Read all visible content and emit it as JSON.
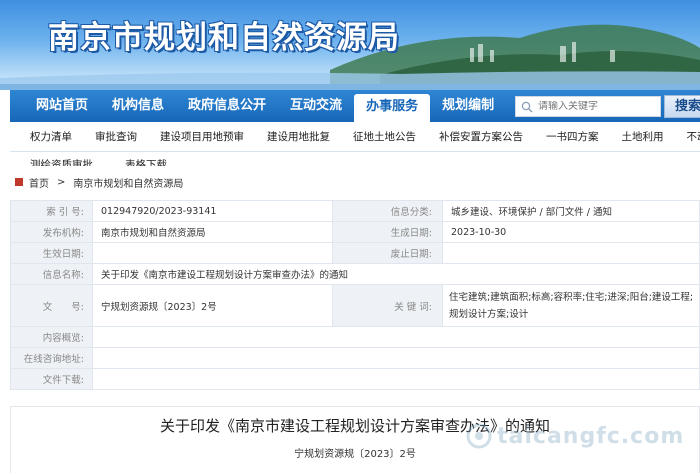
{
  "banner": {
    "title": "南京市规划和自然资源局"
  },
  "nav": {
    "items": [
      "网站首页",
      "机构信息",
      "政府信息公开",
      "互动交流",
      "办事服务",
      "规划编制"
    ],
    "active_index": 4,
    "search_placeholder": "请输入关键字",
    "search_button": "搜索"
  },
  "subnav": {
    "items": [
      "权力清单",
      "审批查询",
      "建设项目用地预审",
      "建设用地批复",
      "征地土地公告",
      "补偿安置方案公告",
      "一书四方案",
      "土地利用",
      "不动产业务查询"
    ],
    "row2": [
      "测绘资质审批",
      "表格下载"
    ]
  },
  "breadcrumb": {
    "home": "首页",
    "current": "南京市规划和自然资源局"
  },
  "info": {
    "index_label": "索 引 号:",
    "index_value": "012947920/2023-93141",
    "category_label": "信息分类:",
    "category_value": "城乡建设、环境保护 / 部门文件 / 通知",
    "publisher_label": "发布机构:",
    "publisher_value": "南京市规划和自然资源局",
    "created_label": "生成日期:",
    "created_value": "2023-10-30",
    "effective_label": "生效日期:",
    "effective_value": "",
    "abolished_label": "废止日期:",
    "abolished_value": "",
    "name_label": "信息名称:",
    "name_value": "关于印发《南京市建设工程规划设计方案审查办法》的通知",
    "docno_label": "文　　号:",
    "docno_value": "宁规划资源规〔2023〕2号",
    "keywords_label": "关 键 词:",
    "keywords_value": "住宅建筑;建筑面积;标高;容积率;住宅;进深;阳台;建设工程;规划设计方案;设计",
    "summary_label": "内容概览:",
    "summary_value": "",
    "consult_label": "在线咨询地址:",
    "consult_value": "",
    "download_label": "文件下载:",
    "download_value": ""
  },
  "document": {
    "title": "关于印发《南京市建设工程规划设计方案审查办法》的通知",
    "number": "宁规划资源规〔2023〕2号"
  },
  "watermark": "taicangfc.com"
}
